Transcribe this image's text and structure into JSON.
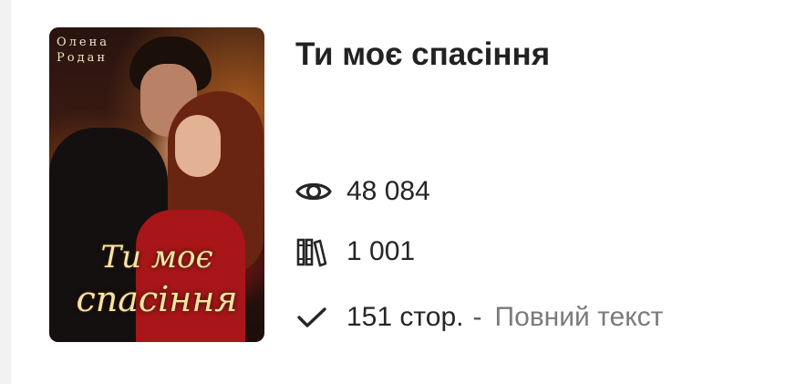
{
  "book": {
    "cover": {
      "author_lines": [
        "Олена",
        "Родан"
      ],
      "title_lines": [
        "Ти моє",
        "спасіння"
      ]
    },
    "title": "Ти моє спасіння",
    "stats": {
      "views": "48 084",
      "views_icon": "eye-icon",
      "library": "1 001",
      "library_icon": "books-icon",
      "pages": "151 стор.",
      "separator": "-",
      "status": "Повний текст",
      "pages_icon": "check-icon"
    }
  },
  "colors": {
    "title": "#222222",
    "text": "#262626",
    "muted": "#7a7a7a",
    "background": "#ffffff"
  }
}
